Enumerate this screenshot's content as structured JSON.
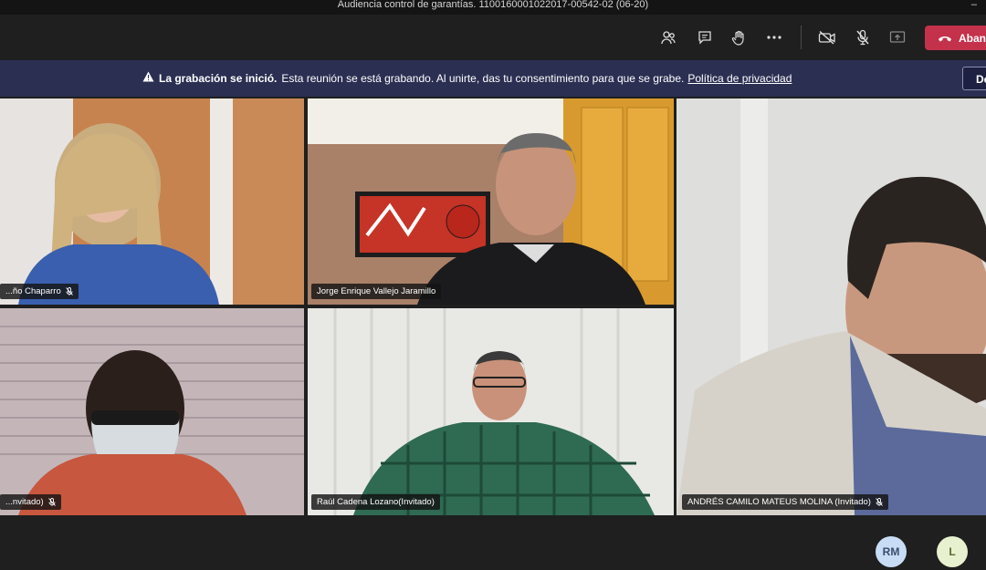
{
  "window": {
    "title": "Audiencia control de garantías. 110016000102201​7-00542-02 (06-20)",
    "minimize": "–"
  },
  "toolbar": {
    "icons": [
      "participants-icon",
      "chat-icon",
      "raise-hand-icon",
      "more-options-icon",
      "camera-off-icon",
      "mic-off-icon",
      "share-screen-icon"
    ],
    "leave_label": "Aban",
    "leave_color": "#c4314b"
  },
  "banner": {
    "title": "La grabación se inició.",
    "message": "Esta reunión se está grabando. Al unirte, das tu consentimiento para que se grabe.",
    "link": "Política de privacidad",
    "dismiss_label": "De",
    "background": "#2b2f52"
  },
  "participants": [
    {
      "name": "...ño Chaparro"
    },
    {
      "name": "Jorge Enrique Vallejo Jaramillo"
    },
    {
      "name": "...nvitado)"
    },
    {
      "name": "Raúl Cadena Lozano(Invitado)"
    },
    {
      "name": "ANDRÉS CAMILO MATEUS MOLINA (Invitado)"
    }
  ],
  "avatars": [
    {
      "initials": "RM",
      "color": "#c9dcf5",
      "text_color": "#3a4c6e"
    },
    {
      "initials": "L",
      "color": "#e8f1cf",
      "text_color": "#5a6a2b"
    }
  ]
}
